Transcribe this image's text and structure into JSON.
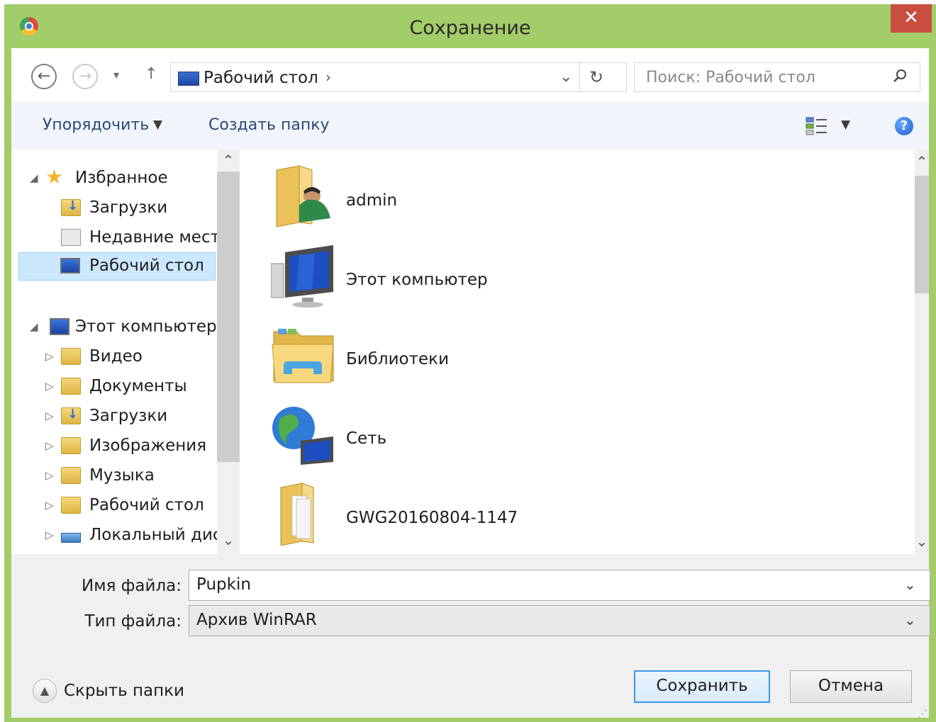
{
  "window": {
    "title": "Сохранение",
    "close_glyph": "✕"
  },
  "navigation": {
    "back_glyph": "←",
    "forward_glyph": "→",
    "recent_glyph": "▾",
    "up_glyph": "↑",
    "address": "Рабочий стол",
    "address_sep": "›",
    "address_drop": "⌄",
    "refresh_glyph": "↻",
    "search_placeholder": "Поиск: Рабочий стол"
  },
  "toolbar": {
    "organize": "Упорядочить",
    "organize_arrow": "▼",
    "new_folder": "Создать папку",
    "view_arrow": "▼",
    "help": "?"
  },
  "nav_tree": {
    "favorites": {
      "label": "Избранное",
      "items": [
        "Загрузки",
        "Недавние места",
        "Рабочий стол"
      ]
    },
    "computer": {
      "label": "Этот компьютер",
      "items": [
        "Видео",
        "Документы",
        "Загрузки",
        "Изображения",
        "Музыка",
        "Рабочий стол",
        "Локальный диск"
      ]
    },
    "expanded_glyph": "◢",
    "collapsed_glyph": "▷"
  },
  "files": [
    "admin",
    "Этот компьютер",
    "Библиотеки",
    "Сеть",
    "GWG20160804-1147"
  ],
  "scroll": {
    "up": "⌃",
    "down": "⌄"
  },
  "form": {
    "filename_label": "Имя файла:",
    "filename_value": "Pupkin",
    "filetype_label": "Тип файла:",
    "filetype_value": "Архив WinRAR",
    "drop_glyph": "⌄"
  },
  "footer": {
    "hide_folders_glyph": "▲",
    "hide_folders": "Скрыть папки",
    "save": "Сохранить",
    "cancel": "Отмена"
  },
  "colors": {
    "frame": "#a2cd68",
    "close": "#c84e3f",
    "selection": "#cce8ff",
    "primary_border": "#3c98e8"
  }
}
